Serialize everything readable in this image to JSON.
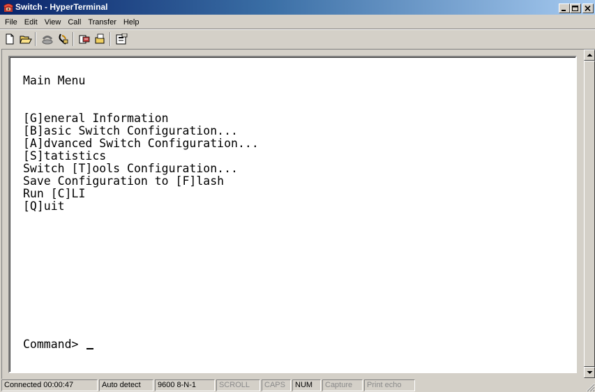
{
  "window": {
    "title": "Switch - HyperTerminal",
    "app_icon": "hyperterminal-phone-icon"
  },
  "menubar": {
    "items": [
      "File",
      "Edit",
      "View",
      "Call",
      "Transfer",
      "Help"
    ]
  },
  "toolbar": {
    "buttons": [
      {
        "name": "new-connection",
        "icon": "new-document-icon"
      },
      {
        "name": "open",
        "icon": "open-folder-icon"
      },
      {
        "name": "connect",
        "icon": "phone-connect-icon"
      },
      {
        "name": "disconnect",
        "icon": "phone-disconnect-icon"
      },
      {
        "name": "send",
        "icon": "send-file-icon"
      },
      {
        "name": "receive",
        "icon": "receive-file-icon"
      },
      {
        "name": "properties",
        "icon": "properties-icon"
      }
    ]
  },
  "terminal": {
    "heading": "Main Menu",
    "menu_lines": [
      "[G]eneral Information",
      "[B]asic Switch Configuration...",
      "[A]dvanced Switch Configuration...",
      "[S]tatistics",
      "Switch [T]ools Configuration...",
      "Save Configuration to [F]lash",
      "Run [C]LI",
      "[Q]uit"
    ],
    "prompt": "Command> "
  },
  "statusbar": {
    "connected": "Connected 00:00:47",
    "detect": "Auto detect",
    "settings": "9600 8-N-1",
    "scroll": "SCROLL",
    "caps": "CAPS",
    "num": "NUM",
    "capture": "Capture",
    "print_echo": "Print echo"
  }
}
